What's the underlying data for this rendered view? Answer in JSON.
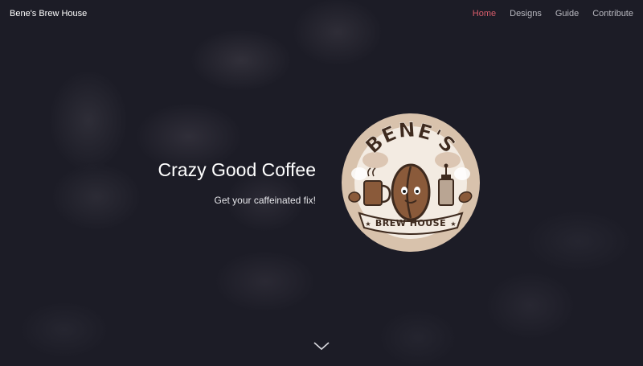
{
  "navbar": {
    "brand": "Bene's Brew House",
    "links": [
      {
        "label": "Home",
        "active": true
      },
      {
        "label": "Designs",
        "active": false
      },
      {
        "label": "Guide",
        "active": false
      },
      {
        "label": "Contribute",
        "active": false
      }
    ]
  },
  "hero": {
    "title": "Crazy Good Coffee",
    "subtitle": "Get your caffeinated fix!"
  },
  "logo": {
    "top_text": "BENE'S",
    "bottom_text": "BREW HOUSE"
  },
  "icons": {
    "scroll": "chevron-down-icon"
  },
  "colors": {
    "background": "#1c1c26",
    "active_link": "#d75d6b",
    "nav_link": "#b9b9c0"
  }
}
